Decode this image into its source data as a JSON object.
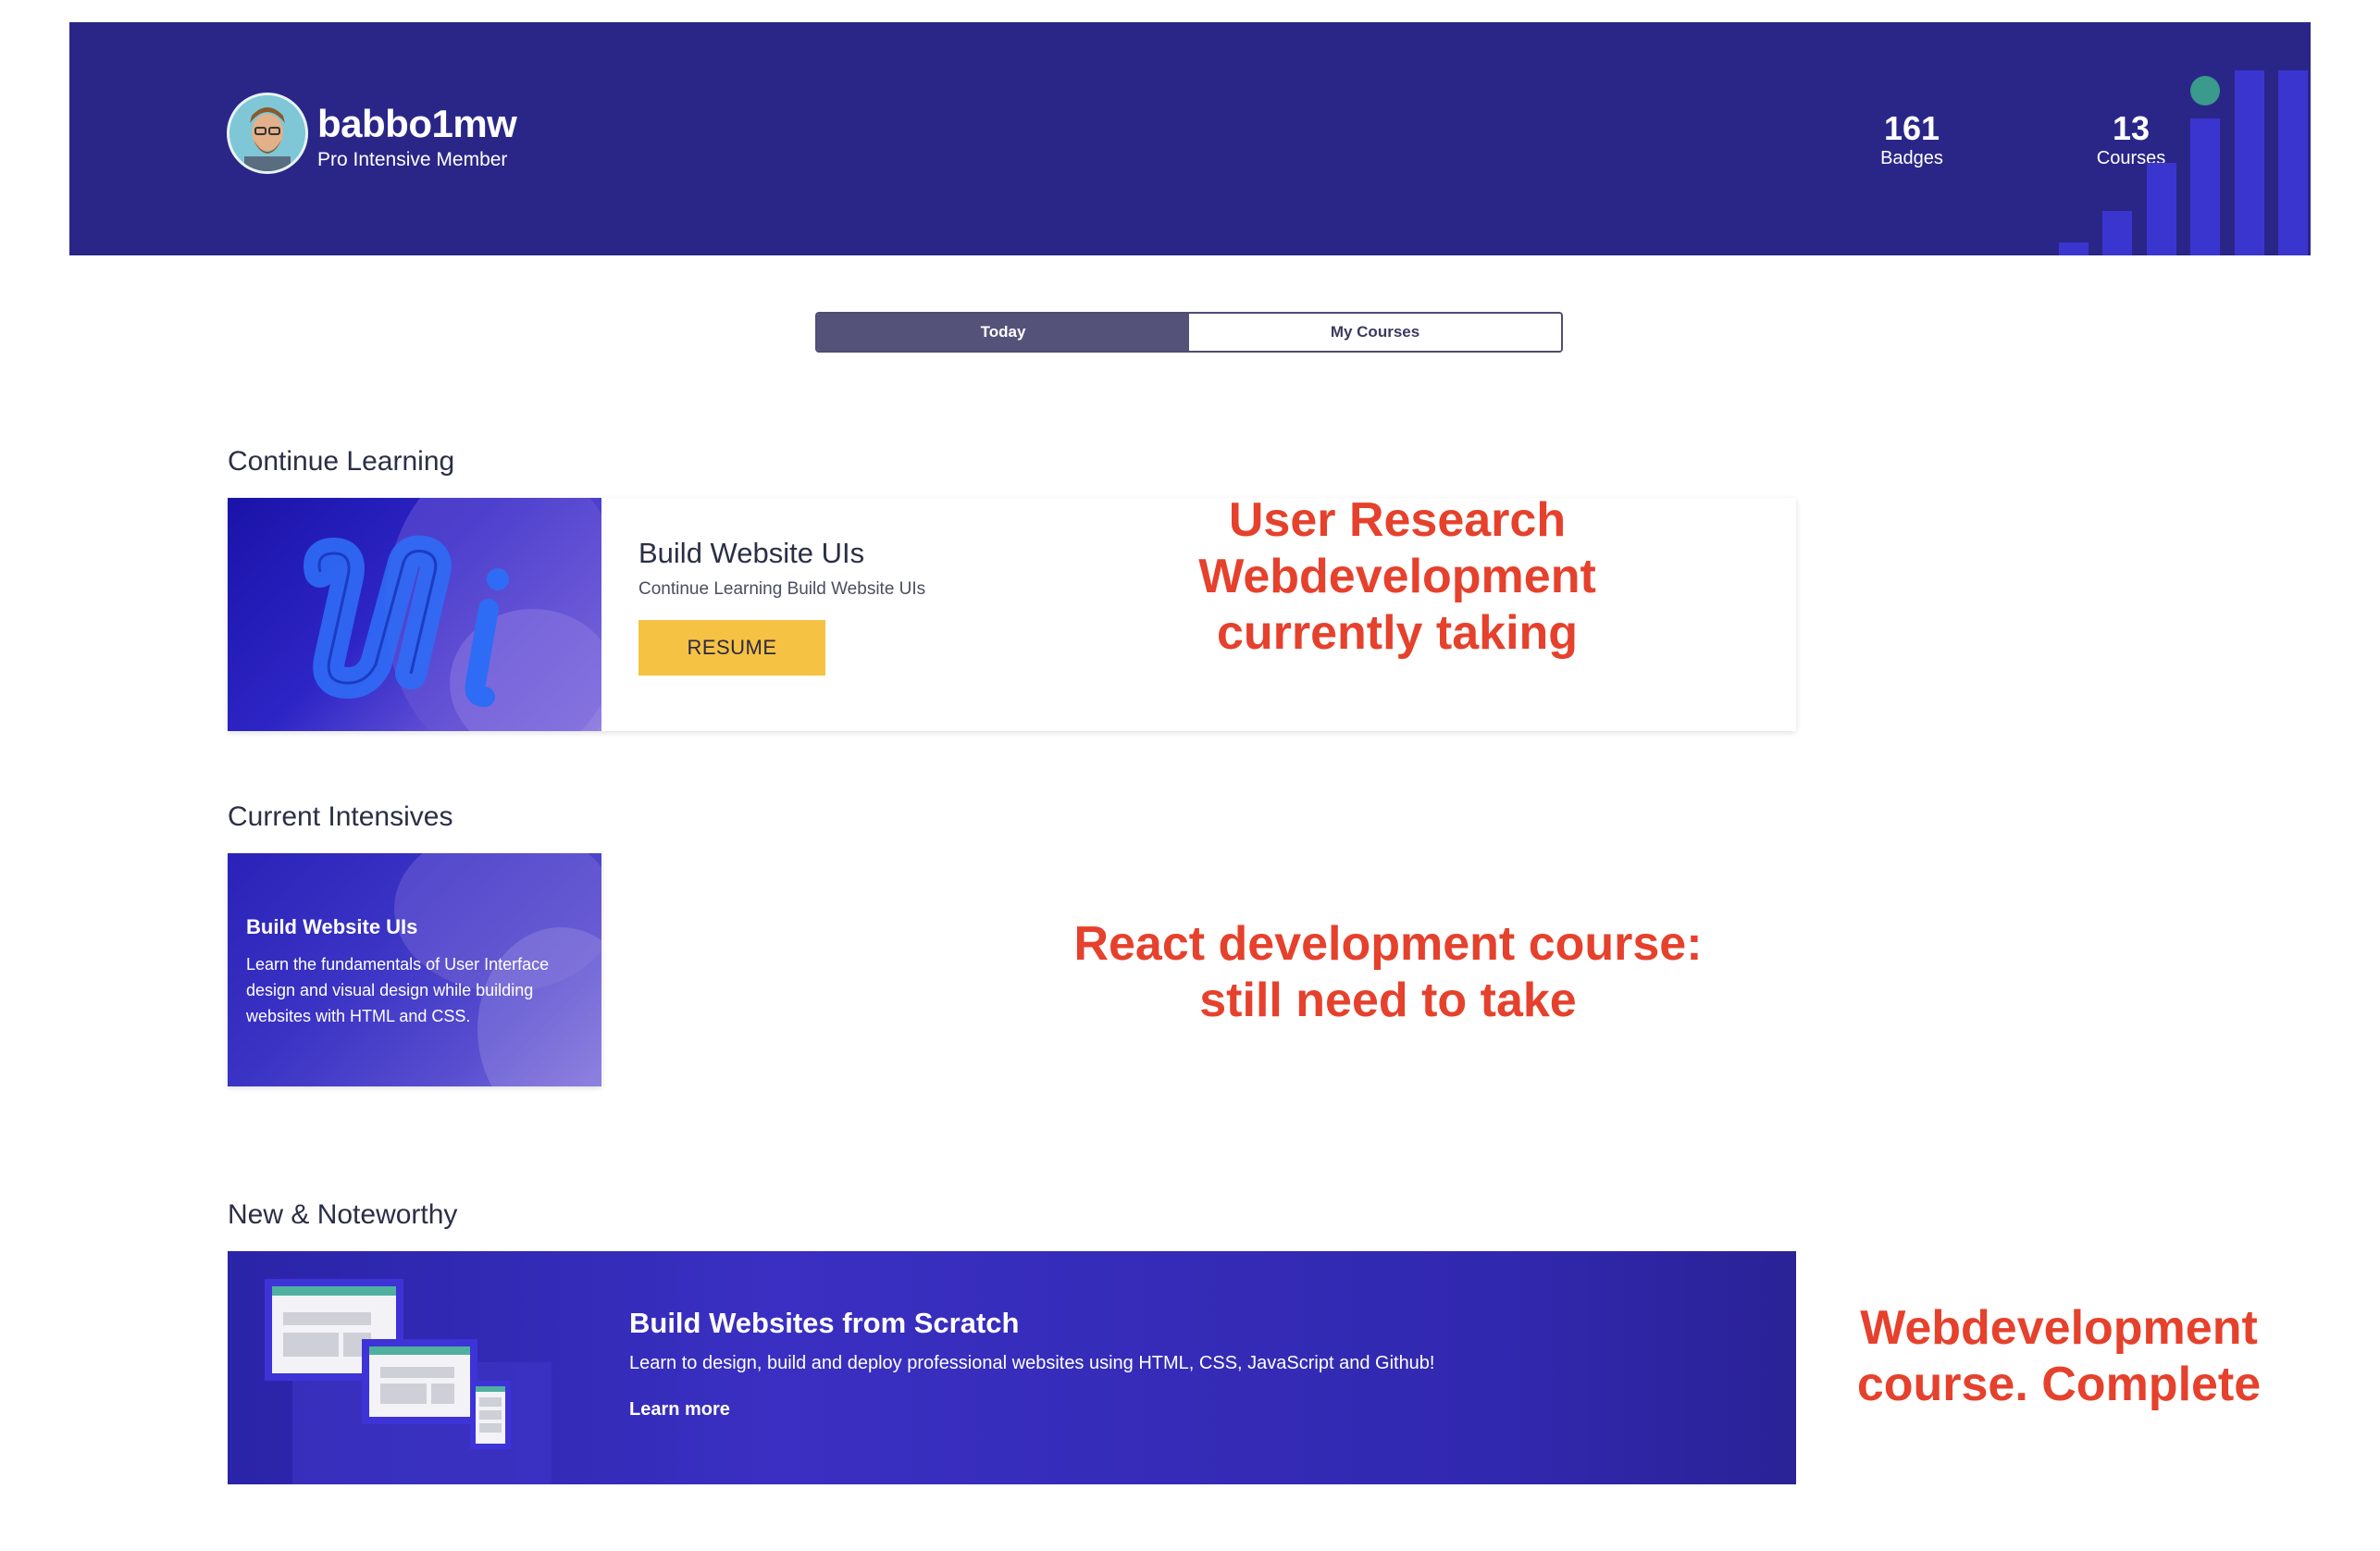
{
  "header": {
    "username": "babbo1mw",
    "membership": "Pro Intensive Member",
    "stats": [
      {
        "value": "161",
        "label": "Badges"
      },
      {
        "value": "13",
        "label": "Courses"
      }
    ]
  },
  "tabs": [
    {
      "label": "Today",
      "active": true
    },
    {
      "label": "My Courses",
      "active": false
    }
  ],
  "continue_learning": {
    "section_title": "Continue Learning",
    "course_title": "Build Website UIs",
    "course_subtitle": "Continue Learning Build Website UIs",
    "button_label": "RESUME"
  },
  "current_intensives": {
    "section_title": "Current Intensives",
    "card_title": "Build Website UIs",
    "card_description": "Learn the fundamentals of User Interface design and visual design while building websites with HTML and CSS."
  },
  "new_noteworthy": {
    "section_title": "New & Noteworthy",
    "banner_title": "Build Websites from Scratch",
    "banner_description": "Learn to design, build and deploy professional websites using HTML, CSS, JavaScript and Github!",
    "link_label": "Learn more"
  },
  "annotations": {
    "annotation_1_lines": [
      "User Research",
      "Webdevelopment",
      "currently taking"
    ],
    "annotation_2_lines": [
      "React development course:",
      "still need to take"
    ],
    "annotation_3_lines": [
      "Webdevelopment",
      "course. Complete"
    ]
  },
  "colors": {
    "header_bg": "#2a2688",
    "accent_yellow": "#f6c244",
    "annotation_red": "#e5412c",
    "tab_active": "#55527a"
  }
}
